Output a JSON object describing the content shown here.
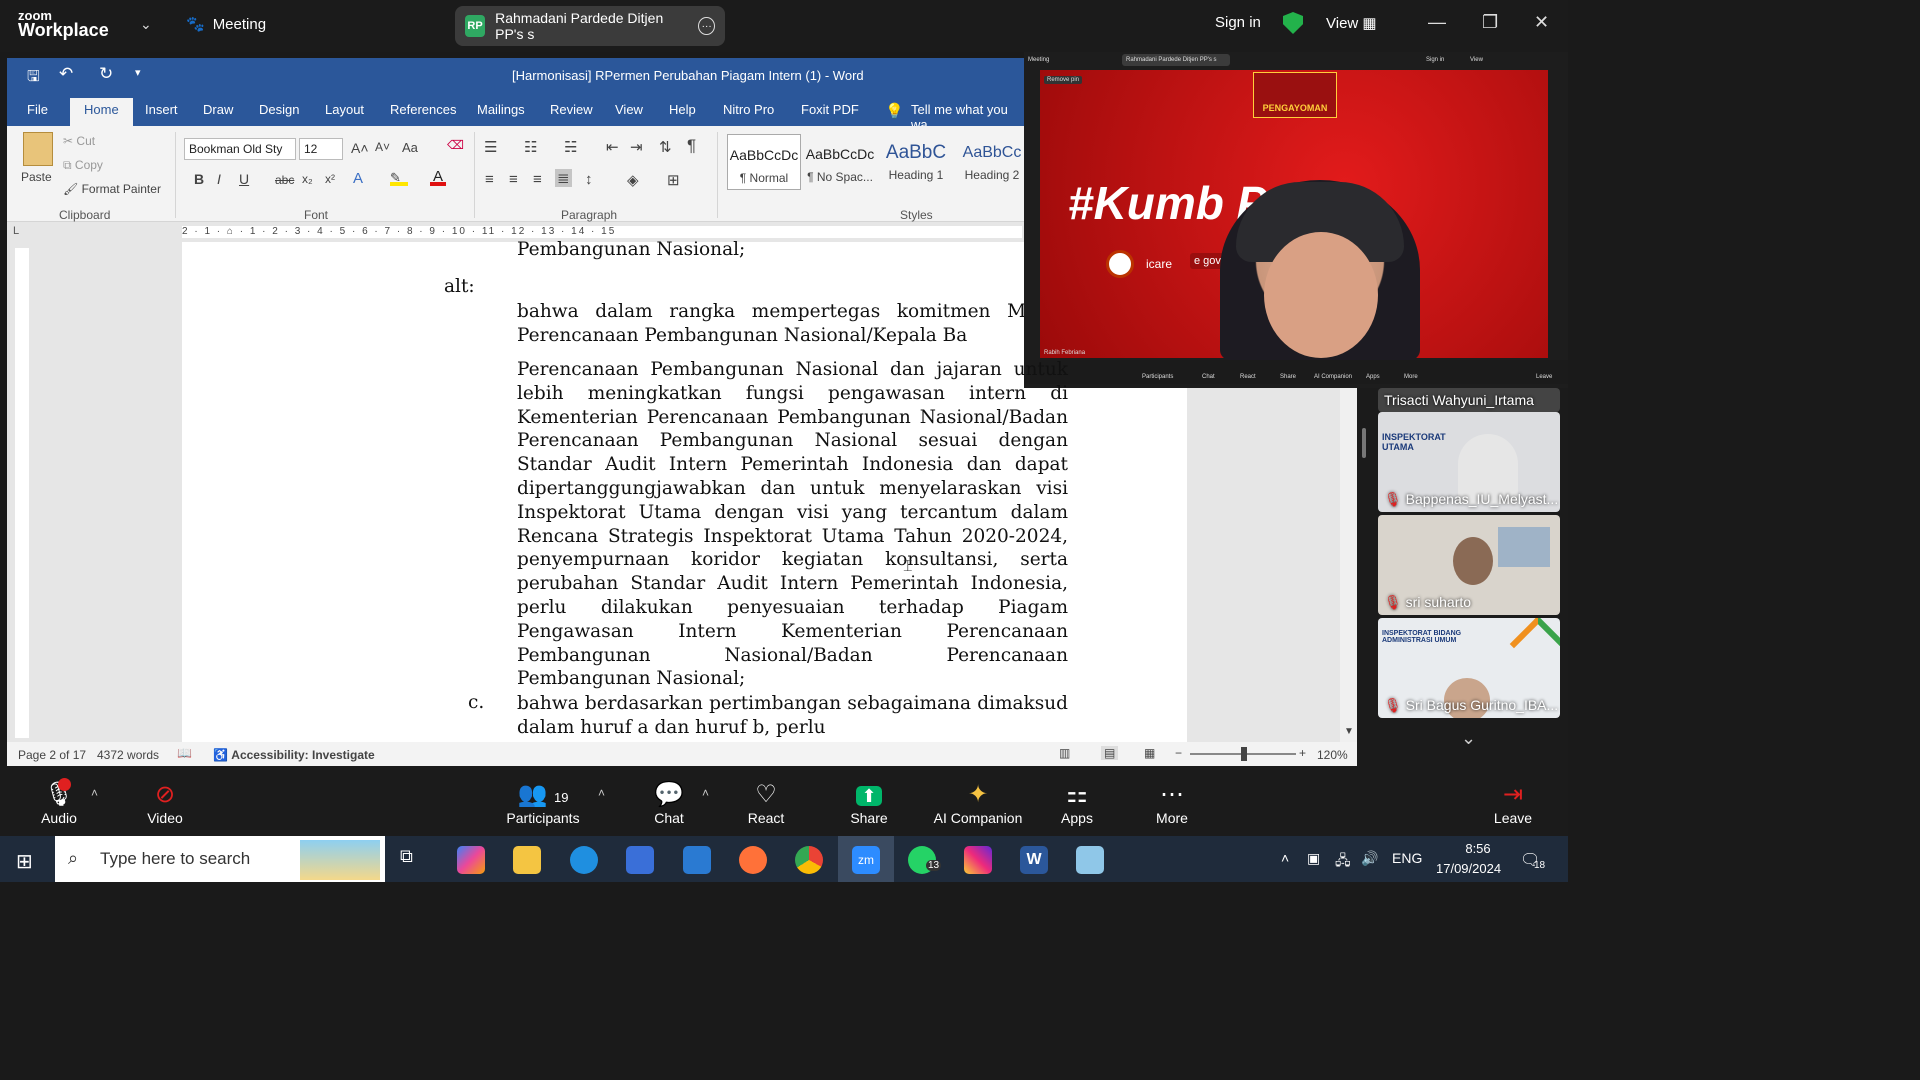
{
  "zoom_top": {
    "logo_small": "zoom",
    "logo_big": "Workplace",
    "meeting_label": "Meeting",
    "share_pill_badge": "RP",
    "share_pill_text": "Rahmadani Pardede Ditjen PP's s",
    "sign_in": "Sign in",
    "view": "View"
  },
  "word": {
    "title": "[Harmonisasi] RPermen Perubahan Piagam Intern (1)  -  Word",
    "tabs": [
      "File",
      "Home",
      "Insert",
      "Draw",
      "Design",
      "Layout",
      "References",
      "Mailings",
      "Review",
      "View",
      "Help",
      "Nitro Pro",
      "Foxit PDF"
    ],
    "tell_me": "Tell me what you wa",
    "clipboard": {
      "paste": "Paste",
      "cut": "Cut",
      "copy": "Copy",
      "format_painter": "Format Painter",
      "group": "Clipboard"
    },
    "font": {
      "family": "Bookman Old Sty",
      "size": "12",
      "group": "Font",
      "case": "Aa"
    },
    "paragraph": {
      "group": "Paragraph"
    },
    "styles": {
      "group": "Styles",
      "items": [
        {
          "sample": "AaBbCcDc",
          "name": "¶ Normal"
        },
        {
          "sample": "AaBbCcDc",
          "name": "¶ No Spac..."
        },
        {
          "sample": "AaBbC",
          "name": "Heading 1"
        },
        {
          "sample": "AaBbCc",
          "name": "Heading 2"
        }
      ]
    },
    "ruler_text": "2 · 1 · ⌂ · 1 · 2 · 3 · 4 · 5 · 6 · 7 · 8 · 9 · 10 · 11 · 12 · 13 · 14 · 15",
    "doc": {
      "line1": "Pembangunan Nasional;",
      "alt_label": "alt:",
      "alt_text": "bahwa dalam rangka mempertegas komitmen Me Perencanaan Pembangunan Nasional/Kepala Ba",
      "para_b": "Perencanaan Pembangunan Nasional dan jajaran untuk lebih meningkatkan fungsi pengawasan intern di Kementerian Perencanaan Pembangunan Nasional/Badan Perencanaan Pembangunan Nasional sesuai dengan Standar Audit Intern Pemerintah Indonesia dan dapat dipertanggungjawabkan dan untuk menyelaraskan visi Inspektorat Utama dengan visi yang tercantum dalam Rencana Strategis Inspektorat Utama Tahun 2020-2024, penyempurnaan koridor kegiatan konsultansi, serta perubahan Standar Audit Intern Pemerintah Indonesia, perlu dilakukan penyesuaian terhadap Piagam Pengawasan Intern Kementerian Perencanaan Pembangunan Nasional/Badan Perencanaan Pembangunan Nasional;",
      "c_label": "c.",
      "c_text": "bahwa berdasarkan pertimbangan sebagaimana dimaksud dalam huruf a dan huruf b, perlu"
    },
    "status": {
      "page": "Page 2 of 17",
      "words": "4372 words",
      "accessibility": "Accessibility: Investigate",
      "zoom": "120%"
    }
  },
  "shared_screen": {
    "hashtag": "#Kumb  Pasti",
    "pengayoman": "PENGAYOMAN",
    "icare": "icare",
    "egov": "e gov",
    "remove_pin": "Remove pin",
    "speaker": "Rabih Febriana",
    "mini_title": "Rahmadani Pardede Ditjen PP's s",
    "mini_meeting": "Meeting",
    "mini_sign": "Sign in",
    "mini_view": "View",
    "mini_toolbar": [
      "Participants",
      "Chat",
      "React",
      "Share",
      "AI Companion",
      "Apps",
      "More",
      "Leave"
    ]
  },
  "participants": {
    "top_name": "Trisacti Wahyuni_Irtama",
    "tiles": [
      {
        "name": "Bappenas_IU_Melyast...",
        "sign": "INSPEKTORAT UTAMA"
      },
      {
        "name": "sri suharto",
        "sign": ""
      },
      {
        "name": "Sri Bagus Guritno_IBA...",
        "sign": "INSPEKTORAT BIDANG ADMINISTRASI UMUM"
      }
    ]
  },
  "zoom_bottom": {
    "buttons": [
      {
        "label": "Audio",
        "icon": "🎙"
      },
      {
        "label": "Video",
        "icon": "📹"
      },
      {
        "label": "Participants",
        "icon": "👥",
        "count": "19"
      },
      {
        "label": "Chat",
        "icon": "💬"
      },
      {
        "label": "React",
        "icon": "♡"
      },
      {
        "label": "Share",
        "icon": "⬆"
      },
      {
        "label": "AI Companion",
        "icon": "✦"
      },
      {
        "label": "Apps",
        "icon": "⚏"
      },
      {
        "label": "More",
        "icon": "⋯"
      },
      {
        "label": "Leave",
        "icon": "⇥"
      }
    ]
  },
  "taskbar": {
    "search_placeholder": "Type here to search",
    "lang": "ENG",
    "time": "8:56",
    "date": "17/09/2024",
    "notif_count": "18",
    "whatsapp_count": "13",
    "zoom_icon": "zm"
  },
  "colors": {
    "word_blue": "#2b579a",
    "zoom_green": "#00b66a",
    "red_bg": "#d01414"
  }
}
